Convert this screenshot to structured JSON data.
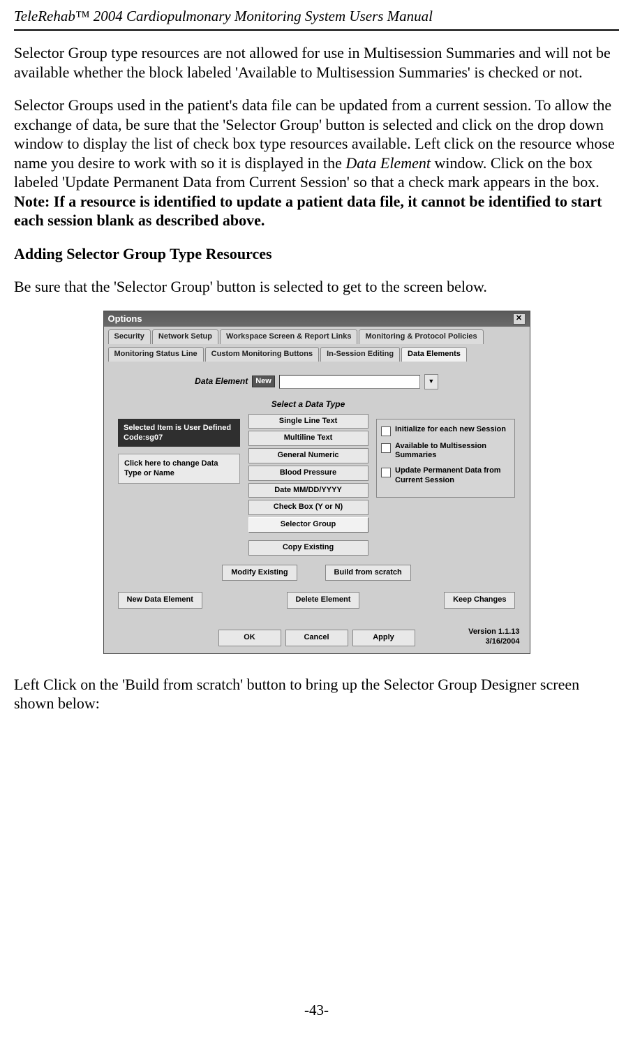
{
  "doc": {
    "header": "TeleRehab™ 2004 Cardiopulmonary Monitoring System Users Manual",
    "pageNumber": "-43-",
    "p1": "Selector Group type resources are not allowed for use in Multisession Summaries and will not be available whether the block labeled 'Available to Multisession Summaries' is checked or not.",
    "p2_a": "Selector Groups used in the patient's data file can be updated from a current session. To allow the exchange of data, be sure that the 'Selector Group' button is selected and click on the drop down window to display the list of check box type resources available. Left click on the resource whose name you desire to work with so it is displayed in the ",
    "p2_italic": "Data Element",
    "p2_b": " window.  Click on the box labeled 'Update Permanent Data from Current Session' so that a check mark appears in the box. ",
    "p2_bold": "Note: If a resource is identified to update a patient data file, it cannot be identified to start each session blank as described above.",
    "heading": "Adding Selector Group Type Resources",
    "p3": "Be sure that the 'Selector Group' button is selected to get to the screen below.",
    "p4": "Left Click on the 'Build from scratch' button to bring up the Selector Group Designer screen shown below:"
  },
  "dialog": {
    "title": "Options",
    "closeGlyph": "✕",
    "tabsRow1": [
      "Security",
      "Network Setup",
      "Workspace Screen & Report Links",
      "Monitoring & Protocol Policies"
    ],
    "tabsRow2": [
      "Monitoring Status Line",
      "Custom Monitoring Buttons",
      "In-Session Editing",
      "Data Elements"
    ],
    "activeTab": "Data Elements",
    "dataElementLabel": "Data Element",
    "newBadge": "New",
    "dropdownGlyph": "▼",
    "typeHeading": "Select a Data Type",
    "typeButtons": [
      "Single Line Text",
      "Multiline Text",
      "General Numeric",
      "Blood Pressure",
      "Date MM/DD/YYYY",
      "Check Box (Y or N)",
      "Selector Group"
    ],
    "copyExisting": "Copy Existing",
    "leftCalloutDark": "Selected Item is  User Defined  Code:sg07",
    "leftCalloutLight": "Click here to change Data Type or Name",
    "checkboxes": [
      "Initialize for each new Session",
      "Available to Multisession Summaries",
      "Update Permanent Data from Current Session"
    ],
    "modifyExisting": "Modify Existing",
    "buildFromScratch": "Build from scratch",
    "newDataElement": "New Data Element",
    "deleteElement": "Delete Element",
    "keepChanges": "Keep Changes",
    "ok": "OK",
    "cancel": "Cancel",
    "apply": "Apply",
    "versionLine1": "Version 1.1.13",
    "versionLine2": "3/16/2004"
  }
}
